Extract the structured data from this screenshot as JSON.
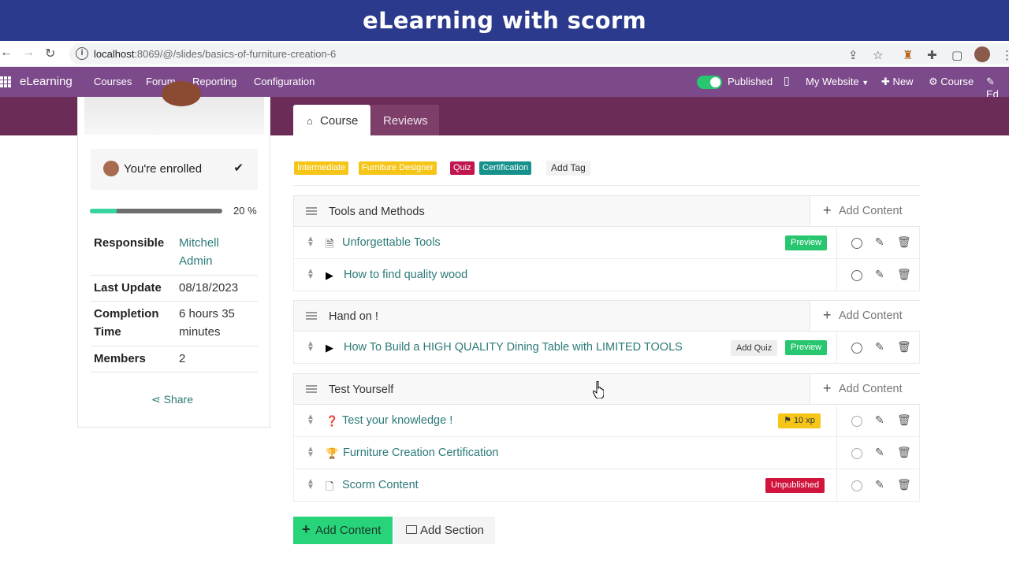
{
  "banner": {
    "title": "eLearning with scorm"
  },
  "browser": {
    "url_host": "localhost",
    "url_rest": ":8069/@/slides/basics-of-furniture-creation-6"
  },
  "navbar": {
    "brand": "eLearning",
    "menu": [
      "Courses",
      "Forum",
      "Reporting",
      "Configuration"
    ],
    "published_label": "Published",
    "website_label": "My Website",
    "new_label": "New",
    "course_label": "Course",
    "edit_label": "Ed"
  },
  "sidebar": {
    "enrolled_text": "You're enrolled",
    "progress_percent": 20,
    "progress_label": "20 %",
    "info": [
      {
        "label": "Responsible",
        "value": "Mitchell Admin"
      },
      {
        "label": "Last Update",
        "value": "08/18/2023"
      },
      {
        "label": "Completion Time",
        "value": "6 hours 35 minutes"
      },
      {
        "label": "Members",
        "value": "2"
      }
    ],
    "share_label": "Share"
  },
  "tabs": {
    "course": "Course",
    "reviews": "Reviews"
  },
  "tags": [
    {
      "label": "Intermediate",
      "color": "#f5c518"
    },
    {
      "label": "Furniture Designer",
      "color": "#f5c518"
    },
    {
      "label": "Quiz",
      "color": "#c0174e"
    },
    {
      "label": "Certification",
      "color": "#17918c"
    }
  ],
  "add_tag_label": "Add Tag",
  "add_content_label": "Add Content",
  "sections": [
    {
      "name": "Tools and Methods",
      "items": [
        {
          "icon": "pdf-icon",
          "title": "Unforgettable Tools",
          "badge": "Preview"
        },
        {
          "icon": "youtube-icon",
          "title": "How to find quality wood",
          "badge": ""
        }
      ]
    },
    {
      "name": "Hand on !",
      "items": [
        {
          "icon": "youtube-icon",
          "title": "How To Build a HIGH QUALITY Dining Table with LIMITED TOOLS",
          "badge": "Preview",
          "extra": "Add Quiz"
        }
      ]
    },
    {
      "name": "Test Yourself",
      "items": [
        {
          "icon": "question-icon",
          "title": "Test your knowledge !",
          "badge": "10 xp"
        },
        {
          "icon": "trophy-icon",
          "title": "Furniture Creation Certification",
          "badge": ""
        },
        {
          "icon": "file-icon",
          "title": "Scorm Content",
          "badge": "Unpublished"
        }
      ]
    }
  ],
  "buttons": {
    "add_content": "Add Content",
    "add_section": "Add Section"
  },
  "colors": {
    "banner": "#2b3a8c",
    "navbar": "#7c4a8a",
    "band": "#6b2d57",
    "link": "#2b7a77",
    "preview": "#28c76f",
    "unpublished": "#d0143c",
    "xp": "#f5c518"
  }
}
